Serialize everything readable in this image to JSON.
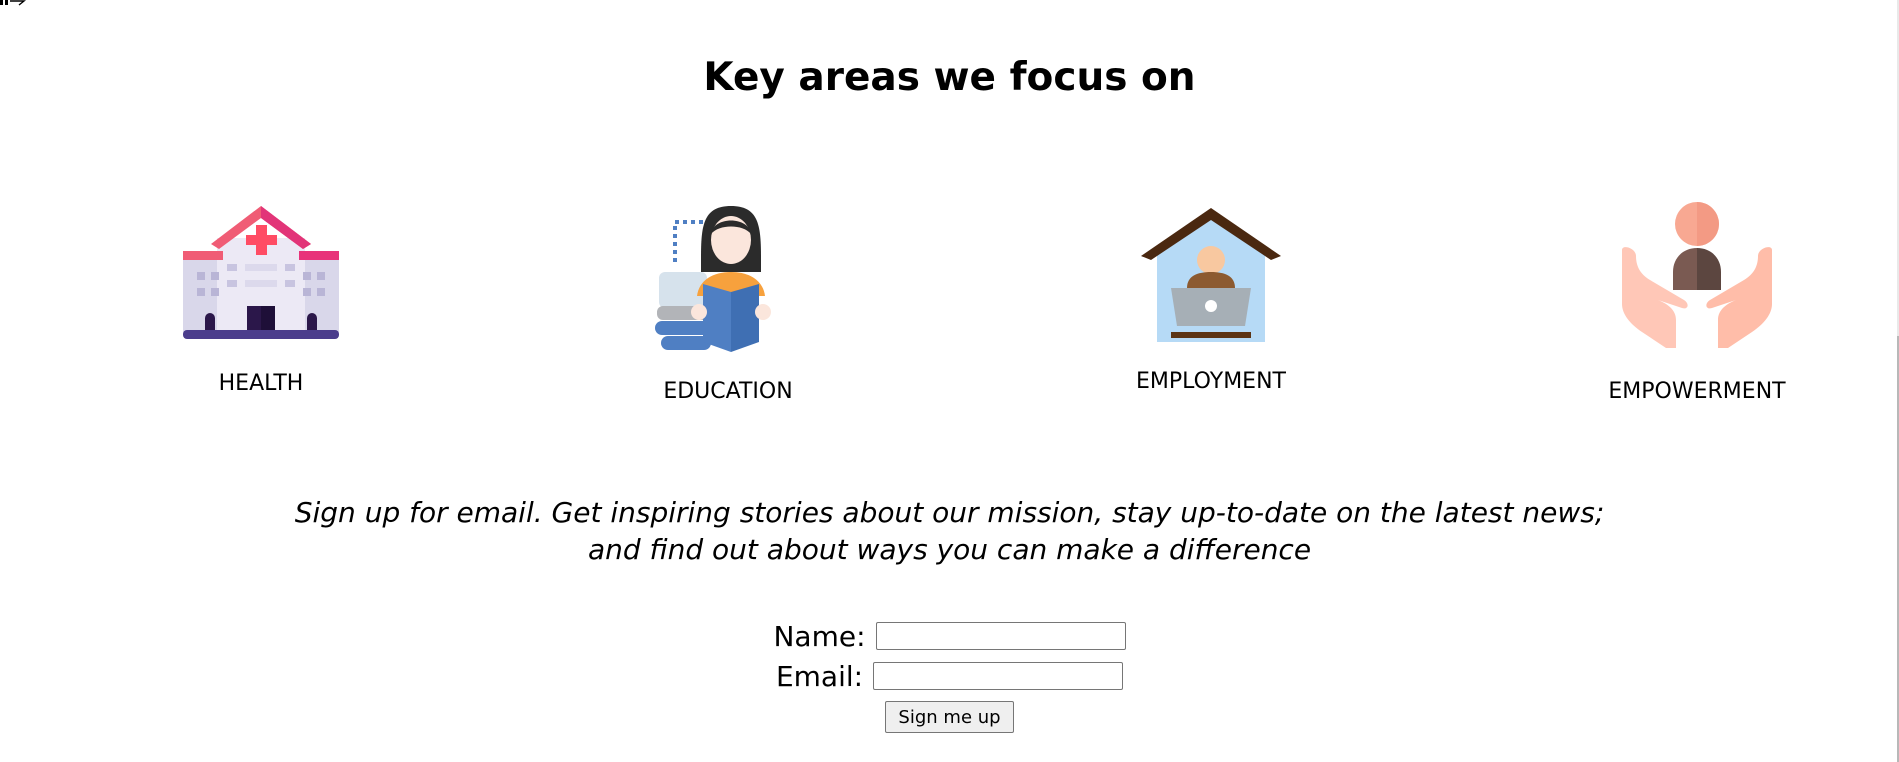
{
  "section": {
    "title": "Key areas we focus on"
  },
  "focus_areas": [
    {
      "label": "HEALTH",
      "icon": "hospital-icon"
    },
    {
      "label": "EDUCATION",
      "icon": "reading-woman-icon"
    },
    {
      "label": "EMPLOYMENT",
      "icon": "work-from-home-icon"
    },
    {
      "label": "EMPOWERMENT",
      "icon": "hands-person-icon"
    }
  ],
  "signup": {
    "text_line1": "Sign up for email. Get inspiring stories about our mission, stay up-to-date on the latest news;",
    "text_line2": "and find out about ways you can make a difference",
    "name_label": "Name:",
    "name_value": "",
    "email_label": "Email:",
    "email_value": "",
    "button_label": "Sign me up"
  }
}
